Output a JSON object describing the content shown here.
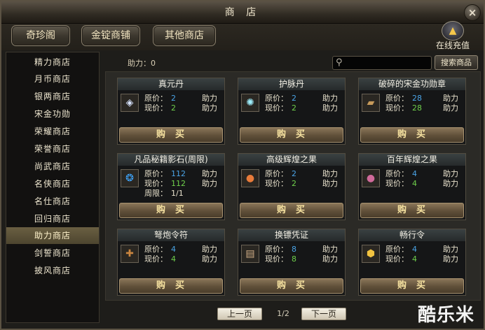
{
  "window": {
    "title": "商 店",
    "close_glyph": "×"
  },
  "tabs": [
    {
      "label": "奇珍阁"
    },
    {
      "label": "金锭商铺"
    },
    {
      "label": "其他商店"
    }
  ],
  "recharge": {
    "label": "在线充值",
    "icon": "gold-coins-icon"
  },
  "sidebar": {
    "items": [
      {
        "label": "精力商店",
        "active": false
      },
      {
        "label": "月币商店",
        "active": false
      },
      {
        "label": "银两商店",
        "active": false
      },
      {
        "label": "宋金功勋",
        "active": false
      },
      {
        "label": "荣耀商店",
        "active": false
      },
      {
        "label": "荣誉商店",
        "active": false
      },
      {
        "label": "尚武商店",
        "active": false
      },
      {
        "label": "名侠商店",
        "active": false
      },
      {
        "label": "名仕商店",
        "active": false
      },
      {
        "label": "回归商店",
        "active": false
      },
      {
        "label": "助力商店",
        "active": true
      },
      {
        "label": "剑誓商店",
        "active": false
      },
      {
        "label": "披风商店",
        "active": false
      }
    ]
  },
  "currency": {
    "label": "助力：",
    "value": "0"
  },
  "search": {
    "icon": "search-icon",
    "placeholder": "",
    "button_label": "搜索商品"
  },
  "items": [
    {
      "name": "真元丹",
      "icon": "crystal-gem-icon",
      "orig_label": "原价：",
      "orig_price": "2",
      "orig_unit": "助力",
      "cur_label": "现价：",
      "cur_price": "2",
      "cur_unit": "助力",
      "buy_label": "购买"
    },
    {
      "name": "护脉丹",
      "icon": "glowing-orb-icon",
      "orig_label": "原价：",
      "orig_price": "2",
      "orig_unit": "助力",
      "cur_label": "现价：",
      "cur_price": "2",
      "cur_unit": "助力",
      "buy_label": "购买"
    },
    {
      "name": "破碎的宋金功勋章",
      "icon": "broken-medal-icon",
      "orig_label": "原价：",
      "orig_price": "28",
      "orig_unit": "助力",
      "cur_label": "现价：",
      "cur_price": "28",
      "cur_unit": "助力",
      "buy_label": "购买"
    },
    {
      "name": "凡品秘籍影石(周限)",
      "icon": "blue-shadow-stone-icon",
      "orig_label": "原价：",
      "orig_price": "112",
      "orig_unit": "助力",
      "cur_label": "现价：",
      "cur_price": "112",
      "cur_unit": "助力",
      "limit_label": "周限：",
      "limit_value": "1/1",
      "buy_label": "购买"
    },
    {
      "name": "高级辉煌之果",
      "icon": "fruit-icon",
      "orig_label": "原价：",
      "orig_price": "2",
      "orig_unit": "助力",
      "cur_label": "现价：",
      "cur_price": "2",
      "cur_unit": "助力",
      "buy_label": "购买"
    },
    {
      "name": "百年辉煌之果",
      "icon": "fruit-icon",
      "orig_label": "原价：",
      "orig_price": "4",
      "orig_unit": "助力",
      "cur_label": "现价：",
      "cur_price": "4",
      "cur_unit": "助力",
      "buy_label": "购买"
    },
    {
      "name": "弩炮令符",
      "icon": "crossbow-token-icon",
      "orig_label": "原价：",
      "orig_price": "4",
      "orig_unit": "助力",
      "cur_label": "现价：",
      "cur_price": "4",
      "cur_unit": "助力",
      "buy_label": "购买"
    },
    {
      "name": "换镖凭证",
      "icon": "certificate-icon",
      "orig_label": "原价：",
      "orig_price": "8",
      "orig_unit": "助力",
      "cur_label": "现价：",
      "cur_price": "8",
      "cur_unit": "助力",
      "buy_label": "购买"
    },
    {
      "name": "畅行令",
      "icon": "gold-token-icon",
      "orig_label": "原价：",
      "orig_price": "4",
      "orig_unit": "助力",
      "cur_label": "现价：",
      "cur_price": "4",
      "cur_unit": "助力",
      "buy_label": "购买"
    }
  ],
  "pager": {
    "prev_label": "上一页",
    "page": "1/2",
    "next_label": "下一页"
  },
  "watermark": "酷乐米",
  "colors": {
    "price_blue": "#4aa3e6",
    "price_green": "#6fcf4b",
    "active_tab": "#5b5034"
  }
}
